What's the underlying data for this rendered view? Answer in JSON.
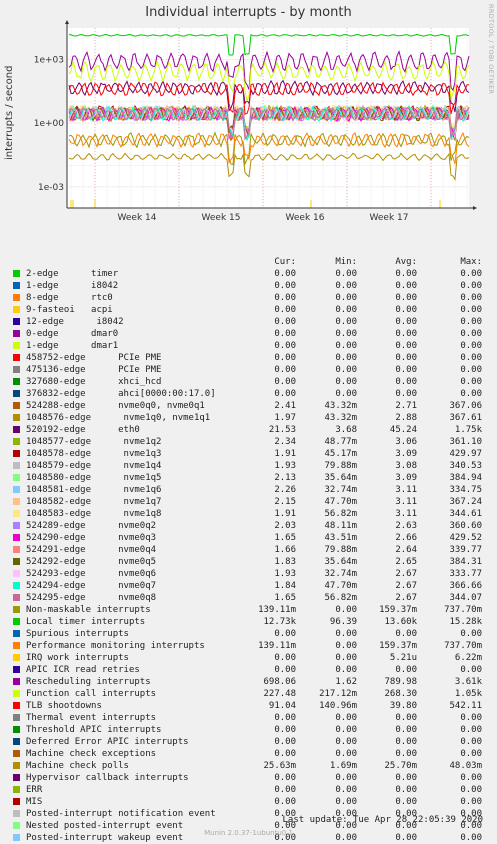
{
  "title": "Individual interrupts - by month",
  "side_label": "RRDTOOL / TOBI OETIKER",
  "footer": {
    "last_update": "Last update: Tue Apr 28 22:05:39 2020",
    "munin": "Munin 2.0.37-1ubuntu0.1"
  },
  "legend_header": {
    "cur": "Cur:",
    "min": "Min:",
    "avg": "Avg:",
    "max": "Max:"
  },
  "chart_data": {
    "type": "line",
    "title": "Individual interrupts - by month",
    "ylabel": "interrupts / second",
    "yscale": "log",
    "ylim": [
      0.0001,
      30000
    ],
    "y_ticks": [
      "1e+03",
      "1e+00",
      "1e-03"
    ],
    "x_ticks": [
      "Week 14",
      "Week 15",
      "Week 16",
      "Week 17"
    ],
    "series": [
      {
        "name": "2-edge      timer",
        "color": "#00cc00",
        "cur": "0.00",
        "min": "0.00",
        "avg": "0.00",
        "max": "0.00"
      },
      {
        "name": "1-edge      i8042",
        "color": "#0066b3",
        "cur": "0.00",
        "min": "0.00",
        "avg": "0.00",
        "max": "0.00"
      },
      {
        "name": "8-edge      rtc0",
        "color": "#ff8000",
        "cur": "0.00",
        "min": "0.00",
        "avg": "0.00",
        "max": "0.00"
      },
      {
        "name": "9-fasteoi   acpi",
        "color": "#ffcc00",
        "cur": "0.00",
        "min": "0.00",
        "avg": "0.00",
        "max": "0.00"
      },
      {
        "name": "12-edge      i8042",
        "color": "#330099",
        "cur": "0.00",
        "min": "0.00",
        "avg": "0.00",
        "max": "0.00"
      },
      {
        "name": "0-edge      dmar0",
        "color": "#990099",
        "cur": "0.00",
        "min": "0.00",
        "avg": "0.00",
        "max": "0.00"
      },
      {
        "name": "1-edge      dmar1",
        "color": "#ccff00",
        "cur": "0.00",
        "min": "0.00",
        "avg": "0.00",
        "max": "0.00"
      },
      {
        "name": "458752-edge      PCIe PME",
        "color": "#ff0000",
        "cur": "0.00",
        "min": "0.00",
        "avg": "0.00",
        "max": "0.00"
      },
      {
        "name": "475136-edge      PCIe PME",
        "color": "#808080",
        "cur": "0.00",
        "min": "0.00",
        "avg": "0.00",
        "max": "0.00"
      },
      {
        "name": "327680-edge      xhci_hcd",
        "color": "#008f00",
        "cur": "0.00",
        "min": "0.00",
        "avg": "0.00",
        "max": "0.00"
      },
      {
        "name": "376832-edge      ahci[0000:00:17.0]",
        "color": "#00487d",
        "cur": "0.00",
        "min": "0.00",
        "avg": "0.00",
        "max": "0.00"
      },
      {
        "name": "524288-edge      nvme0q0, nvme0q1",
        "color": "#b35a00",
        "cur": "2.41",
        "min": "43.32m",
        "avg": "2.71",
        "max": "367.06"
      },
      {
        "name": "1048576-edge      nvme1q0, nvme1q1",
        "color": "#b38f00",
        "cur": "1.97",
        "min": "43.32m",
        "avg": "2.88",
        "max": "367.61"
      },
      {
        "name": "520192-edge      eth0",
        "color": "#6b006b",
        "cur": "21.53",
        "min": "3.68",
        "avg": "45.24",
        "max": "1.75k"
      },
      {
        "name": "1048577-edge      nvme1q2",
        "color": "#8fb300",
        "cur": "2.34",
        "min": "48.77m",
        "avg": "3.06",
        "max": "361.10"
      },
      {
        "name": "1048578-edge      nvme1q3",
        "color": "#b30000",
        "cur": "1.91",
        "min": "45.17m",
        "avg": "3.09",
        "max": "429.97"
      },
      {
        "name": "1048579-edge      nvme1q4",
        "color": "#bebebe",
        "cur": "1.93",
        "min": "79.88m",
        "avg": "3.08",
        "max": "340.53"
      },
      {
        "name": "1048580-edge      nvme1q5",
        "color": "#80ff80",
        "cur": "2.13",
        "min": "35.64m",
        "avg": "3.09",
        "max": "384.94"
      },
      {
        "name": "1048581-edge      nvme1q6",
        "color": "#80c9ff",
        "cur": "2.26",
        "min": "32.74m",
        "avg": "3.11",
        "max": "334.75"
      },
      {
        "name": "1048582-edge      nvme1q7",
        "color": "#ffc080",
        "cur": "2.15",
        "min": "47.70m",
        "avg": "3.11",
        "max": "367.24"
      },
      {
        "name": "1048583-edge      nvme1q8",
        "color": "#ffe680",
        "cur": "1.91",
        "min": "56.82m",
        "avg": "3.11",
        "max": "344.61"
      },
      {
        "name": "524289-edge      nvme0q2",
        "color": "#aa80ff",
        "cur": "2.03",
        "min": "48.11m",
        "avg": "2.63",
        "max": "360.60"
      },
      {
        "name": "524290-edge      nvme0q3",
        "color": "#ee00cc",
        "cur": "1.65",
        "min": "43.51m",
        "avg": "2.66",
        "max": "429.52"
      },
      {
        "name": "524291-edge      nvme0q4",
        "color": "#ff8080",
        "cur": "1.66",
        "min": "79.88m",
        "avg": "2.64",
        "max": "339.77"
      },
      {
        "name": "524292-edge      nvme0q5",
        "color": "#666600",
        "cur": "1.83",
        "min": "35.64m",
        "avg": "2.65",
        "max": "384.31"
      },
      {
        "name": "524293-edge      nvme0q6",
        "color": "#ffbfff",
        "cur": "1.93",
        "min": "32.74m",
        "avg": "2.67",
        "max": "333.77"
      },
      {
        "name": "524294-edge      nvme0q7",
        "color": "#00ffcc",
        "cur": "1.84",
        "min": "47.70m",
        "avg": "2.67",
        "max": "366.66"
      },
      {
        "name": "524295-edge      nvme0q8",
        "color": "#cc6699",
        "cur": "1.65",
        "min": "56.82m",
        "avg": "2.67",
        "max": "344.07"
      },
      {
        "name": "Non-maskable interrupts",
        "color": "#999900",
        "cur": "139.11m",
        "min": "0.00",
        "avg": "159.37m",
        "max": "737.70m"
      },
      {
        "name": "Local timer interrupts",
        "color": "#00cc00",
        "cur": "12.73k",
        "min": "96.39",
        "avg": "13.60k",
        "max": "15.28k"
      },
      {
        "name": "Spurious interrupts",
        "color": "#0066b3",
        "cur": "0.00",
        "min": "0.00",
        "avg": "0.00",
        "max": "0.00"
      },
      {
        "name": "Performance monitoring interrupts",
        "color": "#ff8000",
        "cur": "139.11m",
        "min": "0.00",
        "avg": "159.37m",
        "max": "737.70m"
      },
      {
        "name": "IRQ work interrupts",
        "color": "#ffcc00",
        "cur": "0.00",
        "min": "0.00",
        "avg": "5.21u",
        "max": "6.22m"
      },
      {
        "name": "APIC ICR read retries",
        "color": "#330099",
        "cur": "0.00",
        "min": "0.00",
        "avg": "0.00",
        "max": "0.00"
      },
      {
        "name": "Rescheduling interrupts",
        "color": "#990099",
        "cur": "698.06",
        "min": "1.62",
        "avg": "789.98",
        "max": "3.61k"
      },
      {
        "name": "Function call interrupts",
        "color": "#ccff00",
        "cur": "227.48",
        "min": "217.12m",
        "avg": "268.30",
        "max": "1.05k"
      },
      {
        "name": "TLB shootdowns",
        "color": "#ff0000",
        "cur": "91.04",
        "min": "140.96m",
        "avg": "39.80",
        "max": "542.11"
      },
      {
        "name": "Thermal event interrupts",
        "color": "#808080",
        "cur": "0.00",
        "min": "0.00",
        "avg": "0.00",
        "max": "0.00"
      },
      {
        "name": "Threshold APIC interrupts",
        "color": "#008f00",
        "cur": "0.00",
        "min": "0.00",
        "avg": "0.00",
        "max": "0.00"
      },
      {
        "name": "Deferred Error APIC interrupts",
        "color": "#00487d",
        "cur": "0.00",
        "min": "0.00",
        "avg": "0.00",
        "max": "0.00"
      },
      {
        "name": "Machine check exceptions",
        "color": "#b35a00",
        "cur": "0.00",
        "min": "0.00",
        "avg": "0.00",
        "max": "0.00"
      },
      {
        "name": "Machine check polls",
        "color": "#b38f00",
        "cur": "25.63m",
        "min": "1.69m",
        "avg": "25.70m",
        "max": "48.03m"
      },
      {
        "name": "Hypervisor callback interrupts",
        "color": "#6b006b",
        "cur": "0.00",
        "min": "0.00",
        "avg": "0.00",
        "max": "0.00"
      },
      {
        "name": "ERR",
        "color": "#8fb300",
        "cur": "0.00",
        "min": "0.00",
        "avg": "0.00",
        "max": "0.00"
      },
      {
        "name": "MIS",
        "color": "#b30000",
        "cur": "0.00",
        "min": "0.00",
        "avg": "0.00",
        "max": "0.00"
      },
      {
        "name": "Posted-interrupt notification event",
        "color": "#bebebe",
        "cur": "0.00",
        "min": "0.00",
        "avg": "0.00",
        "max": "0.00"
      },
      {
        "name": "Nested posted-interrupt event",
        "color": "#80ff80",
        "cur": "0.00",
        "min": "0.00",
        "avg": "0.00",
        "max": "0.00"
      },
      {
        "name": "Posted-interrupt wakeup event",
        "color": "#80c9ff",
        "cur": "0.00",
        "min": "0.00",
        "avg": "0.00",
        "max": "0.00"
      }
    ]
  }
}
